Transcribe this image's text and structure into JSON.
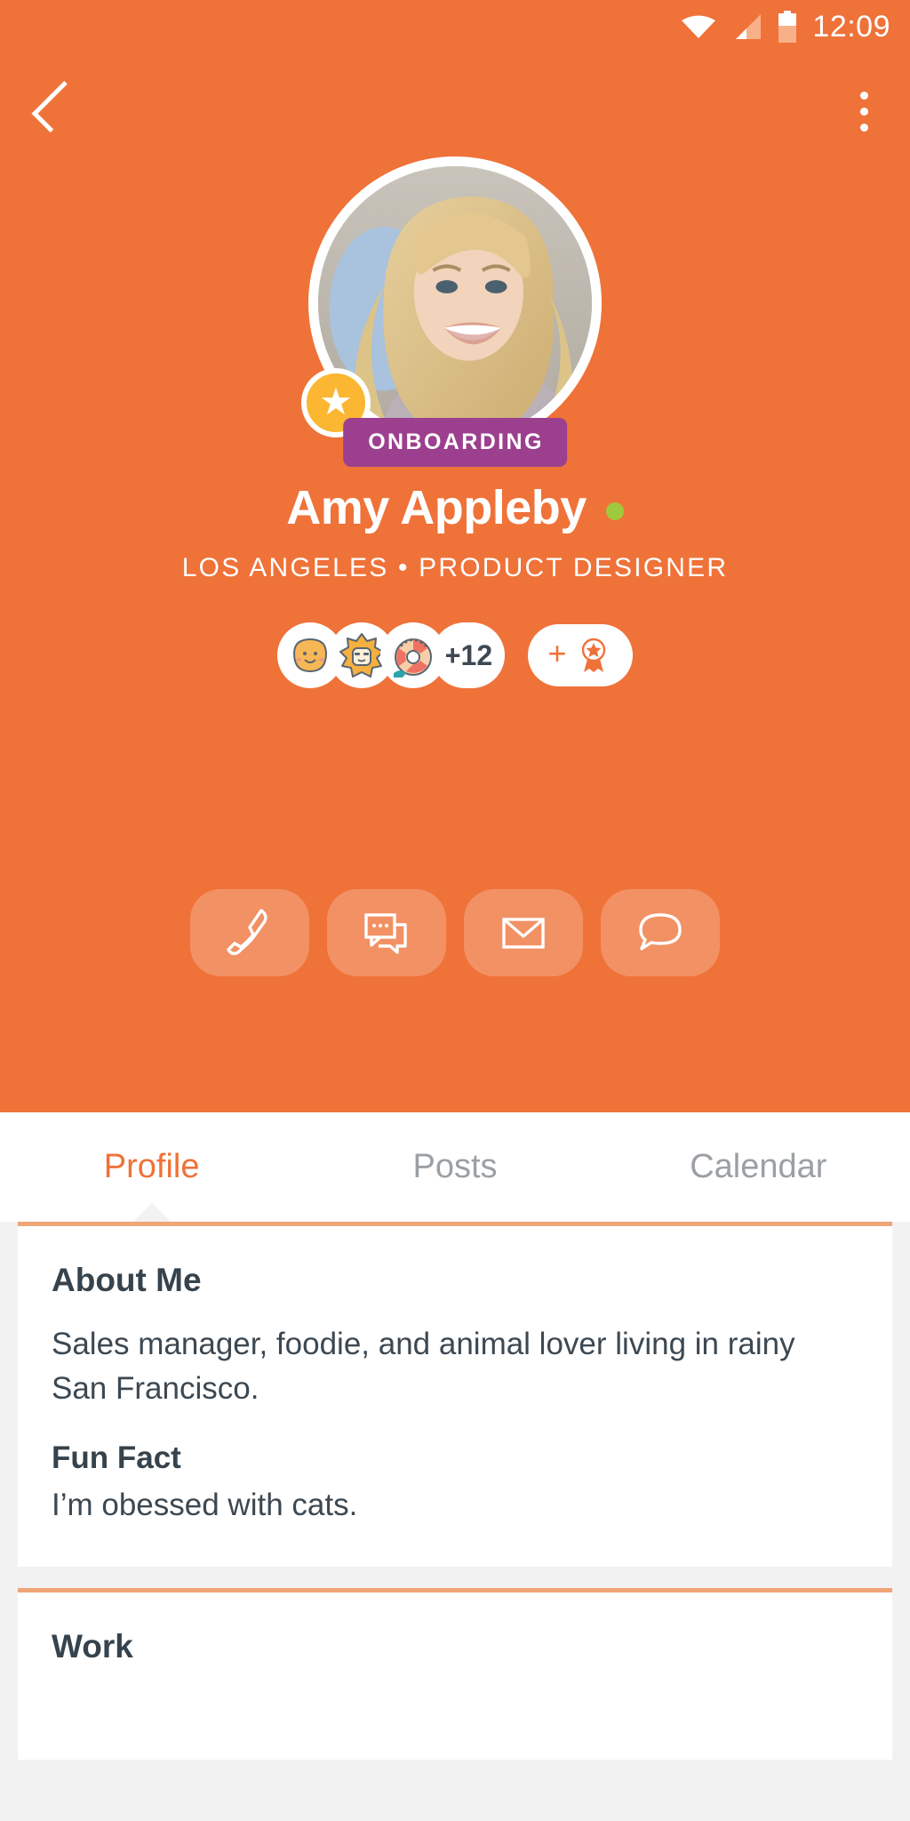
{
  "statusbar": {
    "time": "12:09",
    "icons": [
      "wifi-icon",
      "cell-signal-icon",
      "battery-icon"
    ]
  },
  "topnav": {
    "back_label": "back-arrow",
    "overflow_label": "more-options"
  },
  "profile": {
    "avatar_alt": "Amy Appleby profile photo",
    "star_badge": "★",
    "status_badge": "ONBOARDING",
    "name": "Amy Appleby",
    "online": true,
    "online_color": "#9fc93c",
    "subtitle": "LOS ANGELES • PRODUCT DESIGNER",
    "badges": [
      {
        "name": "blob-face-badge"
      },
      {
        "name": "sun-character-badge"
      },
      {
        "name": "life-preserver-badge"
      }
    ],
    "badge_overflow": "+12",
    "add_badge_plus": "+",
    "add_badge_icon": "award-ribbon-icon"
  },
  "actions": [
    {
      "name": "call-button",
      "icon": "phone-icon"
    },
    {
      "name": "message-button",
      "icon": "chat-bubbles-icon"
    },
    {
      "name": "email-button",
      "icon": "envelope-icon"
    },
    {
      "name": "comment-button",
      "icon": "speech-bubble-icon"
    }
  ],
  "tabs": [
    {
      "label": "Profile",
      "active": true
    },
    {
      "label": "Posts",
      "active": false
    },
    {
      "label": "Calendar",
      "active": false
    }
  ],
  "cards": [
    {
      "title": "About Me",
      "body": "Sales manager, foodie, and animal lover living in rainy San Francisco.",
      "sub_title": "Fun Fact",
      "sub_body": "I’m obessed with cats."
    },
    {
      "title": "Work"
    }
  ],
  "colors": {
    "brand_orange": "#ef7239",
    "badge_purple": "#9c3f8e",
    "star_yellow": "#fbb731",
    "online_green": "#9fc93c",
    "card_accent": "#f0a577",
    "text_dark": "#36434d",
    "text_muted": "#9ba0a5"
  }
}
